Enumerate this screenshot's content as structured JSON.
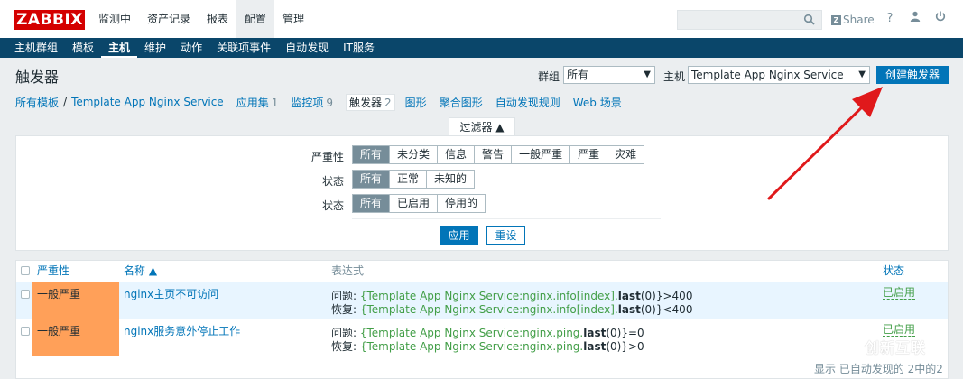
{
  "logo": "ZABBIX",
  "top_menu": [
    "监测中",
    "资产记录",
    "报表",
    "配置",
    "管理"
  ],
  "top_menu_active": 3,
  "top_right": {
    "share": "Share",
    "help": "?"
  },
  "nav": [
    "主机群组",
    "模板",
    "主机",
    "维护",
    "动作",
    "关联项事件",
    "自动发现",
    "IT服务"
  ],
  "nav_active": 2,
  "page_title": "触发器",
  "header": {
    "group_label": "群组",
    "group_value": "所有",
    "host_label": "主机",
    "host_value": "Template App Nginx Service",
    "create_button": "创建触发器"
  },
  "breadcrumb": {
    "root": "所有模板",
    "separator": "/",
    "template": "Template App Nginx Service",
    "tabs": [
      {
        "label": "应用集",
        "count": "1"
      },
      {
        "label": "监控项",
        "count": "9"
      },
      {
        "label": "触发器",
        "count": "2"
      },
      {
        "label": "图形",
        "count": ""
      },
      {
        "label": "聚合图形",
        "count": ""
      },
      {
        "label": "自动发现规则",
        "count": ""
      },
      {
        "label": "Web 场景",
        "count": ""
      }
    ]
  },
  "filter": {
    "tab_label": "过滤器 ▲",
    "severity_label": "严重性",
    "severity_options": [
      "所有",
      "未分类",
      "信息",
      "警告",
      "一般严重",
      "严重",
      "灾难"
    ],
    "state_label": "状态",
    "state_options": [
      "所有",
      "正常",
      "未知的"
    ],
    "status_label": "状态",
    "status_options": [
      "所有",
      "已启用",
      "停用的"
    ],
    "apply": "应用",
    "reset": "重设"
  },
  "table": {
    "headers": {
      "severity": "严重性",
      "name": "名称 ▲",
      "expression": "表达式",
      "status": "状态"
    },
    "rows": [
      {
        "severity": "一般严重",
        "name": "nginx主页不可访问",
        "problem_prefix": "问题: ",
        "problem_key": "{Template App Nginx Service:nginx.info[index].",
        "problem_func": "last",
        "problem_tail": "(0)}>400",
        "recovery_prefix": "恢复: ",
        "recovery_key": "{Template App Nginx Service:nginx.info[index].",
        "recovery_func": "last",
        "recovery_tail": "(0)}<400",
        "status": "已启用"
      },
      {
        "severity": "一般严重",
        "name": "nginx服务意外停止工作",
        "problem_prefix": "问题: ",
        "problem_key": "{Template App Nginx Service:nginx.ping.",
        "problem_func": "last",
        "problem_tail": "(0)}=0",
        "recovery_prefix": "恢复: ",
        "recovery_key": "{Template App Nginx Service:nginx.ping.",
        "recovery_func": "last",
        "recovery_tail": "(0)}>0",
        "status": "已启用"
      }
    ],
    "footer": "显示 已自动发现的 2中的2"
  },
  "watermark": "创新互联",
  "colors": {
    "brand": "#d40000",
    "nav": "#0a466a",
    "accent": "#0275b8",
    "severity_average": "#ffa059",
    "enabled": "#429e47",
    "annotation_arrow": "#e0191b"
  }
}
